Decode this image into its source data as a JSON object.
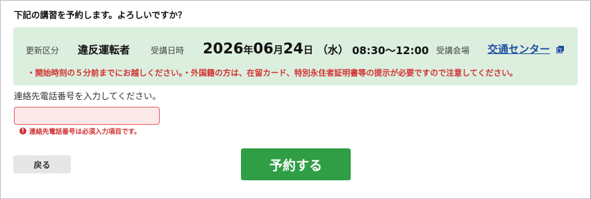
{
  "confirm_question": "下記の講習を予約します。よろしいですか？",
  "course": {
    "renewal_category_label": "更新区分",
    "renewal_category_value": "違反運転者",
    "date_label": "受講日時",
    "date": {
      "year": "2026",
      "year_unit": "年",
      "month": "06",
      "month_unit": "月",
      "day": "24",
      "day_unit": "日",
      "weekday": "（水）"
    },
    "time": "08:30〜12:00",
    "venue_label": "受講会場",
    "venue_link": "交通センター",
    "venue_link_icon": "external-window-icon",
    "notice": "・開始時刻の５分前までにお越しください。・外国籍の方は、在留カード、特別永住者証明書等の提示が必要ですので注意してください。"
  },
  "phone": {
    "label": "連絡先電話番号を入力してください。",
    "value": "",
    "error_icon": "exclamation-circle-icon",
    "error": "連絡先電話番号は必須入力項目です。"
  },
  "buttons": {
    "back": "戻る",
    "reserve": "予約する"
  },
  "colors": {
    "info_box_bg": "#dcefdf",
    "notice_red": "#d23232",
    "link_blue": "#1f4ea3",
    "reserve_green": "#2f9e44",
    "input_error_bg": "#fde8ea",
    "input_error_border": "#e25b66"
  }
}
